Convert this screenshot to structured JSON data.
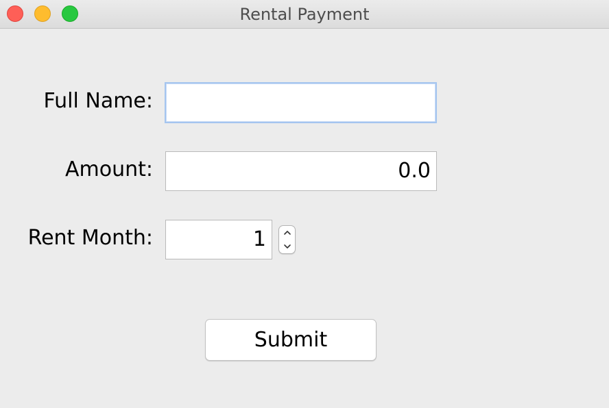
{
  "window": {
    "title": "Rental Payment"
  },
  "form": {
    "full_name": {
      "label": "Full Name:",
      "value": ""
    },
    "amount": {
      "label": "Amount:",
      "value": "0.0"
    },
    "rent_month": {
      "label": "Rent Month:",
      "value": "1"
    },
    "submit_label": "Submit"
  },
  "icons": {
    "close": "close-traffic-light",
    "minimize": "minimize-traffic-light",
    "zoom": "zoom-traffic-light",
    "stepper_up": "chevron-up-icon",
    "stepper_down": "chevron-down-icon"
  },
  "colors": {
    "close": "#fe5f57",
    "minimize": "#febc2e",
    "zoom": "#28c840",
    "focus_ring": "#a5c5ef",
    "window_bg": "#ececec"
  }
}
